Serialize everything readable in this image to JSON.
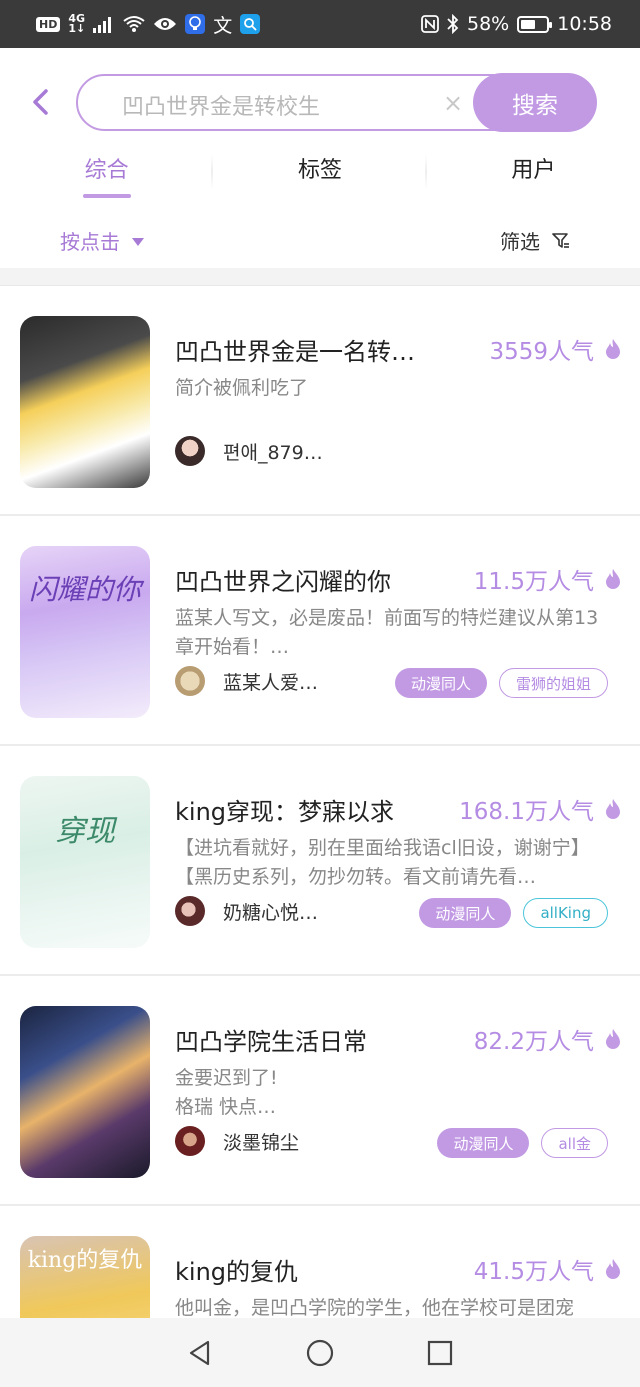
{
  "status_bar": {
    "hd": "HD",
    "network_top": "4G",
    "network_bottom": "1↓",
    "app_text_1": "文",
    "battery_percent": "58%",
    "battery_level": 0.58,
    "time": "10:58"
  },
  "search": {
    "placeholder": "凹凸世界金是转校生",
    "clear_glyph": "×",
    "button_label": "搜索"
  },
  "tabs": [
    {
      "label": "综合",
      "active": true
    },
    {
      "label": "标签",
      "active": false
    },
    {
      "label": "用户",
      "active": false
    }
  ],
  "sort": {
    "label": "按点击"
  },
  "filter": {
    "label": "筛选"
  },
  "results": [
    {
      "title": "凹凸世界金是一名转…",
      "popularity": "3559人气",
      "description": "简介被佩利吃了",
      "author": "편애_879…",
      "tags": [],
      "cover_text": ""
    },
    {
      "title": "凹凸世界之闪耀的你",
      "popularity": "11.5万人气",
      "description": "蓝某人写文，必是废品！前面写的特烂建议从第13章开始看！…",
      "author": "蓝某人爱…",
      "tags": [
        {
          "label": "动漫同人",
          "style": "filled"
        },
        {
          "label": "雷狮的姐姐",
          "style": "outline"
        }
      ],
      "cover_text": "闪耀的你"
    },
    {
      "title": "king穿现：梦寐以求",
      "popularity": "168.1万人气",
      "description": "【进坑看就好，别在里面给我语cl旧设，谢谢宁】【黑历史系列，勿抄勿转。看文前请先看…",
      "author": "奶糖心悦…",
      "tags": [
        {
          "label": "动漫同人",
          "style": "filled"
        },
        {
          "label": "allKing",
          "style": "teal"
        }
      ],
      "cover_text": "穿现"
    },
    {
      "title": "凹凸学院生活日常",
      "popularity": "82.2万人气",
      "description": "金要迟到了!\n格瑞 快点…",
      "author": "淡墨锦尘",
      "tags": [
        {
          "label": "动漫同人",
          "style": "filled"
        },
        {
          "label": "all金",
          "style": "outline"
        }
      ],
      "cover_text": ""
    },
    {
      "title": "king的复仇",
      "popularity": "41.5万人气",
      "description": "他叫金，是凹凸学院的学生，他在学校可是团宠",
      "author": "",
      "tags": [],
      "cover_text": "king的复仇"
    }
  ],
  "colors": {
    "accent": "#c29ae4",
    "accent_text": "#a77ad6",
    "popularity_text": "#b58ce3",
    "teal_tag": "#4cc5da"
  }
}
